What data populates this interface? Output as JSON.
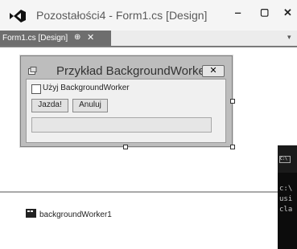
{
  "window": {
    "title": "Pozostałości4 - Form1.cs [Design]",
    "minimize": "‒",
    "maximize": "▢",
    "close": "✕"
  },
  "tab": {
    "label": "Form1.cs [Design]",
    "pin": "⊕",
    "close": "✕",
    "menu": "▾"
  },
  "form": {
    "title": "Przykład BackgroundWorker",
    "close": "✕",
    "checkbox_label": "Użyj BackgroundWorker",
    "checkbox_checked": false,
    "start_button": "Jazda!",
    "cancel_button": "Anuluj",
    "progress": 0
  },
  "tray": {
    "component_label": "backgroundWorker1"
  },
  "console": {
    "icon": "C:\\",
    "lines": [
      "c:\\",
      "usi",
      "cla"
    ]
  },
  "icons": {
    "app": "visual-studio-logo-icon",
    "form_icon": "form-icon",
    "component_icon": "component-icon"
  }
}
